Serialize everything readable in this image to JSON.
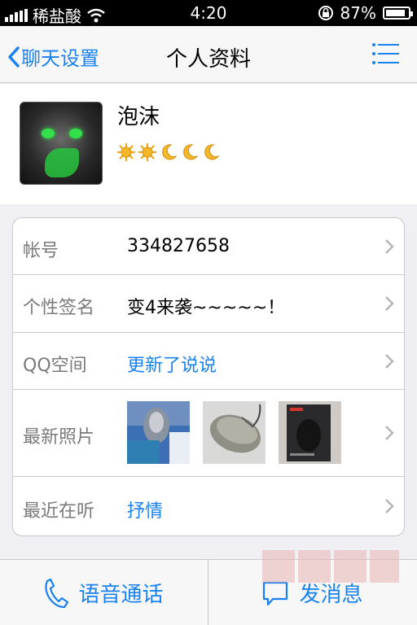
{
  "status_bar": {
    "carrier": "稀盐酸",
    "time": "4:20",
    "battery": "87%",
    "battery_level": 0.87
  },
  "nav": {
    "back_label": "聊天设置",
    "title": "个人资料",
    "menu_icon": "list-icon"
  },
  "profile": {
    "name": "泡沫",
    "level_icons": [
      "sun-icon",
      "sun-icon",
      "moon-icon",
      "moon-icon",
      "moon-icon"
    ]
  },
  "rows": {
    "account": {
      "label": "帐号",
      "value": "334827658"
    },
    "signature": {
      "label": "个性签名",
      "value": "变4来袭~~~~~！"
    },
    "qzone": {
      "label": "QQ空间",
      "value": "更新了说说"
    },
    "photos": {
      "label": "最新照片",
      "items": [
        "photo-1",
        "photo-2",
        "photo-3"
      ]
    },
    "music": {
      "label": "最近在听",
      "value": "抒情"
    }
  },
  "bottom": {
    "call_label": "语音通话",
    "message_label": "发消息"
  },
  "colors": {
    "accent": "#1a82f0",
    "label_gray": "#7a7a7a",
    "background": "#efeff4"
  }
}
